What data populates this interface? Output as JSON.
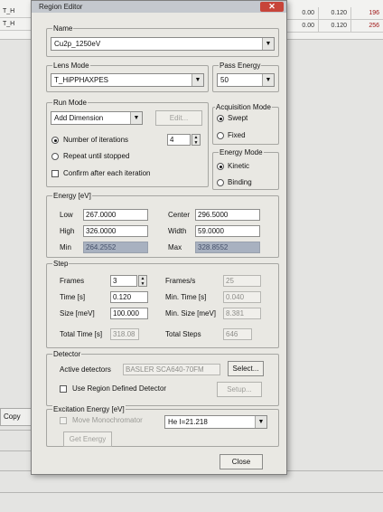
{
  "background": {
    "row_labels": [
      "T_H",
      "T_H"
    ],
    "cells": [
      [
        "0.00",
        "0.120",
        "196"
      ],
      [
        "0.00",
        "0.120",
        "256"
      ]
    ],
    "copy_label": "Copy"
  },
  "dialog": {
    "title": "Region Editor",
    "close_glyph": "✕",
    "name": {
      "legend": "Name",
      "value": "Cu2p_1250eV"
    },
    "lens_mode": {
      "legend": "Lens Mode",
      "value": "T_HiPPHAXPES"
    },
    "pass_energy": {
      "legend": "Pass Energy",
      "value": "50"
    },
    "run_mode": {
      "legend": "Run Mode",
      "value": "Add Dimension",
      "edit_label": "Edit...",
      "number_of_iterations_label": "Number of iterations",
      "iterations_value": "4",
      "repeat_label": "Repeat until stopped",
      "confirm_label": "Confirm after each iteration"
    },
    "acquisition_mode": {
      "legend": "Acquisition Mode",
      "swept_label": "Swept",
      "fixed_label": "Fixed"
    },
    "energy_mode": {
      "legend": "Energy Mode",
      "kinetic_label": "Kinetic",
      "binding_label": "Binding"
    },
    "energy": {
      "legend": "Energy [eV]",
      "low_label": "Low",
      "low_value": "267.0000",
      "center_label": "Center",
      "center_value": "296.5000",
      "high_label": "High",
      "high_value": "326.0000",
      "width_label": "Width",
      "width_value": "59.0000",
      "min_label": "Min",
      "min_value": "264.2552",
      "max_label": "Max",
      "max_value": "328.8552"
    },
    "step": {
      "legend": "Step",
      "frames_label": "Frames",
      "frames_value": "3",
      "frames_per_s_label": "Frames/s",
      "frames_per_s_value": "25",
      "time_label": "Time [s]",
      "time_value": "0.120",
      "min_time_label": "Min. Time [s]",
      "min_time_value": "0.040",
      "size_label": "Size [meV]",
      "size_value": "100.000",
      "min_size_label": "Min. Size [meV]",
      "min_size_value": "8.381",
      "total_time_label": "Total Time [s]",
      "total_time_value": "318.08",
      "total_steps_label": "Total Steps",
      "total_steps_value": "646"
    },
    "detector": {
      "legend": "Detector",
      "active_label": "Active detectors",
      "active_value": "BASLER SCA640-70FM",
      "select_label": "Select...",
      "use_region_label": "Use Region Defined Detector",
      "setup_label": "Setup..."
    },
    "excitation": {
      "legend": "Excitation Energy [eV]",
      "move_mono_label": "Move Monochromator",
      "source_value": "He I=21.218",
      "get_energy_label": "Get Energy"
    },
    "close_label": "Close"
  }
}
